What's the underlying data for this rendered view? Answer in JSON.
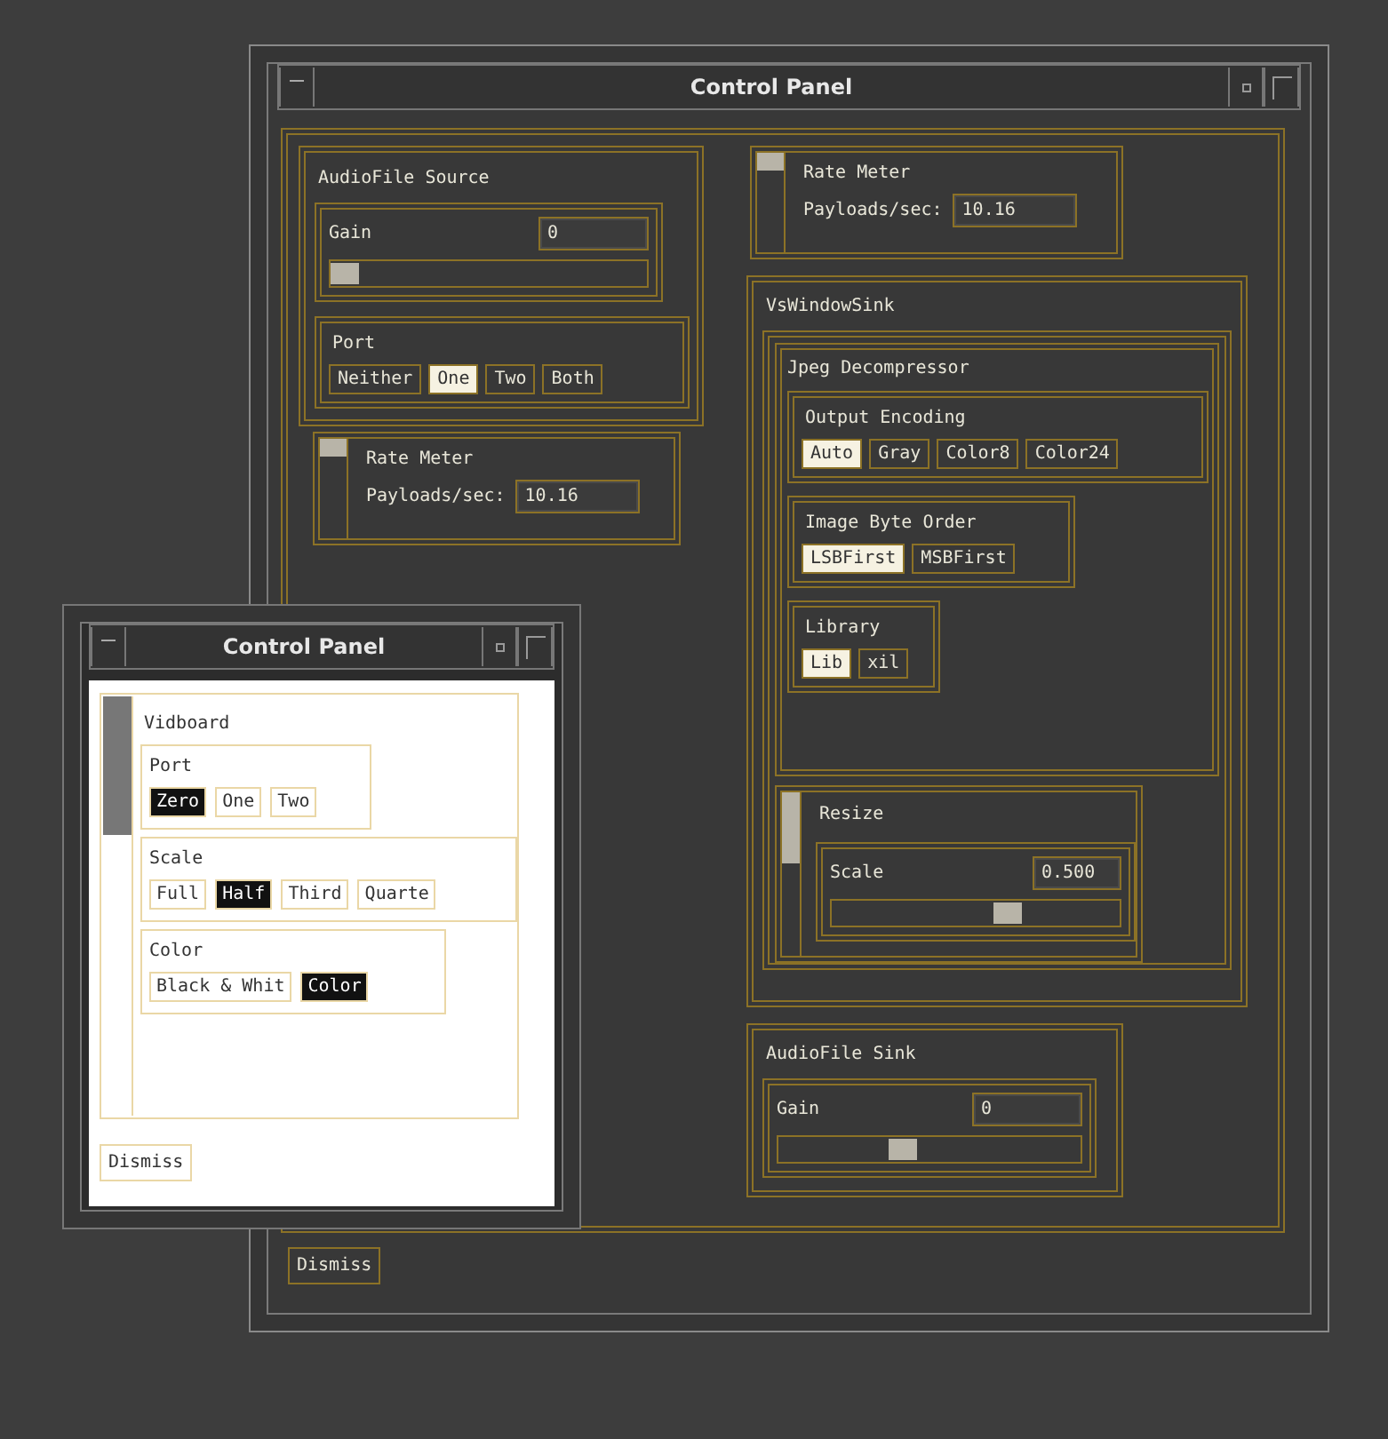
{
  "main_window": {
    "title": "Control Panel",
    "audio_source": {
      "title": "AudioFile Source",
      "gain": {
        "label": "Gain",
        "value": "0",
        "level": 0
      },
      "port": {
        "label": "Port",
        "options": [
          {
            "label": "Neither",
            "selected": false
          },
          {
            "label": "One",
            "selected": true
          },
          {
            "label": "Two",
            "selected": false
          },
          {
            "label": "Both",
            "selected": false
          }
        ]
      }
    },
    "rate_meters": [
      {
        "title": "Rate Meter",
        "label": "Payloads/sec:",
        "value": "10.16"
      },
      {
        "title": "Rate Meter",
        "label": "Payloads/sec:",
        "value": "10.16"
      }
    ],
    "window_sink": {
      "title": "VsWindowSink",
      "decompressor": {
        "title": "Jpeg Decompressor",
        "option_groups": [
          {
            "label": "Output Encoding",
            "options": [
              {
                "label": "Auto",
                "selected": true
              },
              {
                "label": "Gray",
                "selected": false
              },
              {
                "label": "Color8",
                "selected": false
              },
              {
                "label": "Color24",
                "selected": false
              }
            ]
          },
          {
            "label": "Image Byte Order",
            "options": [
              {
                "label": "LSBFirst",
                "selected": true
              },
              {
                "label": "MSBFirst",
                "selected": false
              }
            ]
          },
          {
            "label": "Library",
            "options": [
              {
                "label": "Lib",
                "selected": true
              },
              {
                "label": "xil",
                "selected": false
              }
            ]
          }
        ]
      },
      "resize": {
        "title": "Resize",
        "scale": {
          "label": "Scale",
          "value": "0.500",
          "level": 0.62
        }
      }
    },
    "audio_sink": {
      "title": "AudioFile Sink",
      "gain": {
        "label": "Gain",
        "value": "0",
        "level": 0.4
      }
    },
    "dismiss": "Dismiss"
  },
  "vidboard_window": {
    "title": "Control Panel",
    "group_title": "Vidboard",
    "option_groups": [
      {
        "label": "Port",
        "options": [
          {
            "label": "Zero",
            "selected": true
          },
          {
            "label": "One",
            "selected": false
          },
          {
            "label": "Two",
            "selected": false
          }
        ]
      },
      {
        "label": "Scale",
        "options": [
          {
            "label": "Full",
            "selected": false
          },
          {
            "label": "Half",
            "selected": true
          },
          {
            "label": "Third",
            "selected": false
          },
          {
            "label": "Quarte",
            "selected": false
          }
        ]
      },
      {
        "label": "Color",
        "options": [
          {
            "label": "Black & Whit",
            "selected": false
          },
          {
            "label": "Color",
            "selected": true
          }
        ]
      }
    ],
    "dismiss": "Dismiss"
  }
}
